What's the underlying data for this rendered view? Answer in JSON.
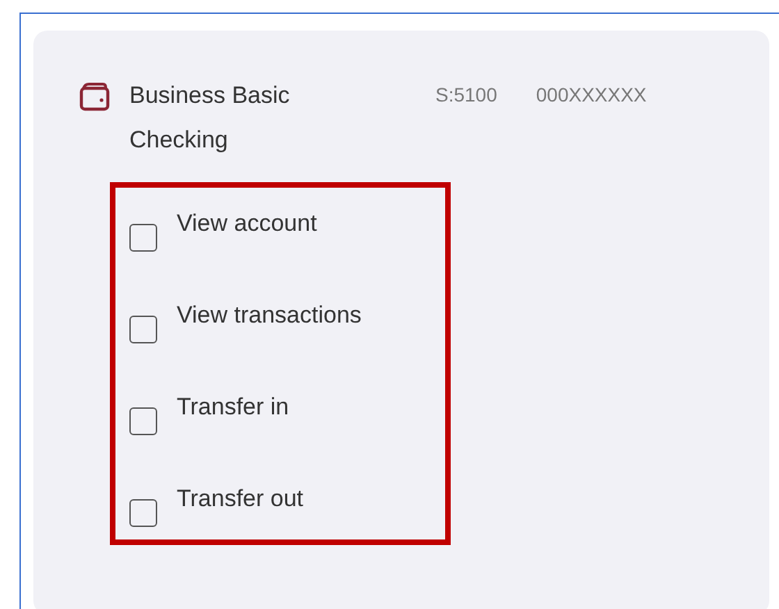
{
  "account": {
    "name_lines": [
      "Business Basic",
      "Checking"
    ],
    "code": "S:5100",
    "number": "000XXXXXX"
  },
  "permissions": [
    {
      "label": "View account",
      "checked": false
    },
    {
      "label": "View transactions",
      "checked": false
    },
    {
      "label": "Transfer in",
      "checked": false
    },
    {
      "label": "Transfer out",
      "checked": false
    }
  ],
  "highlight": {
    "on": true
  }
}
